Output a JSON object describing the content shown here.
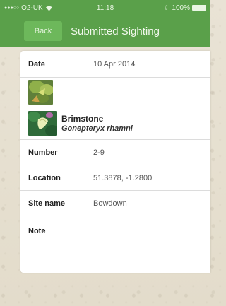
{
  "status": {
    "dots": "●●●○○",
    "carrier": "O2-UK",
    "time": "11:18",
    "battery": "100%"
  },
  "nav": {
    "back_label": "Back",
    "title": "Submitted Sighting"
  },
  "details": {
    "date_label": "Date",
    "date_value": "10 Apr 2014",
    "species_common": "Brimstone",
    "species_latin": "Gonepteryx rhamni",
    "number_label": "Number",
    "number_value": "2-9",
    "location_label": "Location",
    "location_value": "51.3878, -1.2800",
    "site_label": "Site name",
    "site_value": "Bowdown",
    "note_label": "Note",
    "note_value": ""
  },
  "colors": {
    "header_green": "#5aa04a",
    "back_button": "#6db85b",
    "card_bg": "#ffffff"
  },
  "icons": {
    "wifi": "wifi-icon",
    "moon": "moon-icon",
    "battery": "battery-icon",
    "photo": "sighting-photo",
    "species": "species-photo"
  }
}
